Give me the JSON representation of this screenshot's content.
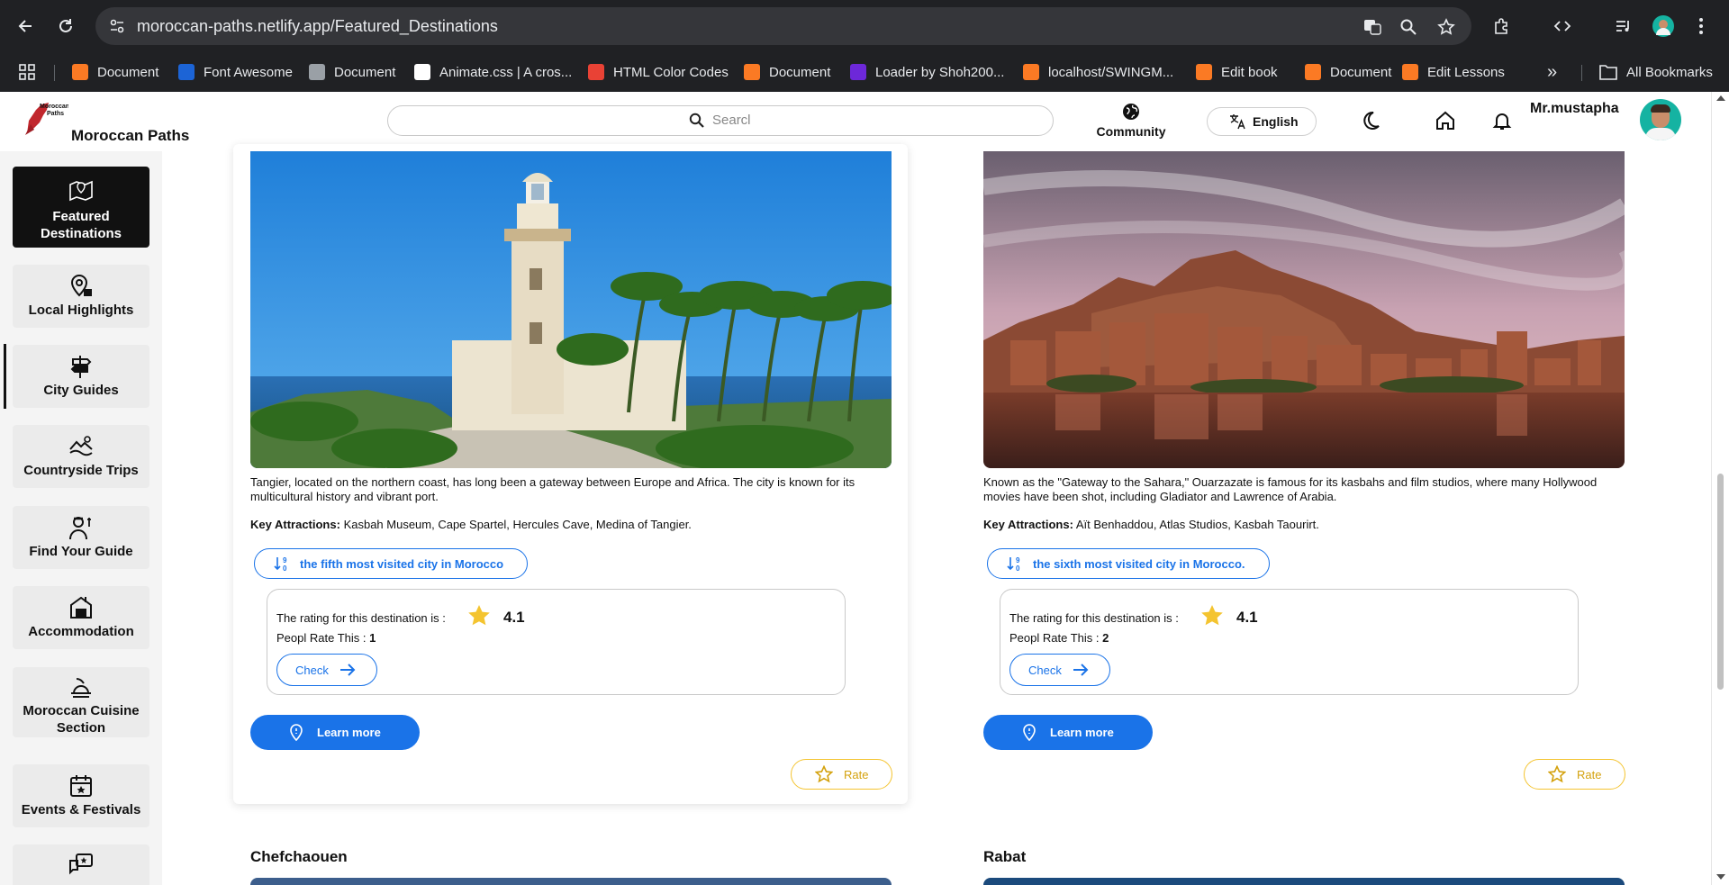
{
  "browser": {
    "url": "moroccan-paths.netlify.app/Featured_Destinations",
    "bookmarks": [
      {
        "label": "Document",
        "icon": "xampp-icon"
      },
      {
        "label": "Font Awesome",
        "icon": "font-awesome-icon"
      },
      {
        "label": "Document",
        "icon": "globe-icon"
      },
      {
        "label": "Animate.css | A cros...",
        "icon": "amazon-icon"
      },
      {
        "label": "HTML Color Codes",
        "icon": "html-color-codes-icon"
      },
      {
        "label": "Document",
        "icon": "xampp-icon"
      },
      {
        "label": "Loader by Shoh200...",
        "icon": "uiverse-icon"
      },
      {
        "label": "localhost/SWINGM...",
        "icon": "xampp-icon"
      },
      {
        "label": "Edit book",
        "icon": "xampp-icon"
      },
      {
        "label": "Document",
        "icon": "xampp-icon"
      },
      {
        "label": "Edit Lessons",
        "icon": "xampp-icon"
      }
    ],
    "all_bookmarks": "All Bookmarks",
    "more_bookmarks": "»"
  },
  "header": {
    "brand": "Moroccan Paths",
    "logo_text": "Moroccan Paths",
    "search_placeholder": "Searcl",
    "community": "Community",
    "language": "English",
    "username": "Mr.mustapha"
  },
  "sidebar": {
    "items": [
      {
        "label": "Featured Destinations",
        "icon": "map-icon",
        "active": true
      },
      {
        "label": "Local Highlights",
        "icon": "location-pin-icon",
        "active": false
      },
      {
        "label": "City Guides",
        "icon": "signpost-icon",
        "active": false
      },
      {
        "label": "Countryside Trips",
        "icon": "landscape-icon",
        "active": false
      },
      {
        "label": "Find Your Guide",
        "icon": "guide-icon",
        "active": false
      },
      {
        "label": "Accommodation",
        "icon": "hotel-icon",
        "active": false
      },
      {
        "label": "Moroccan Cuisine Section",
        "icon": "cuisine-icon",
        "active": false
      },
      {
        "label": "Events & Festivals",
        "icon": "calendar-icon",
        "active": false
      },
      {
        "label": "",
        "icon": "chat-icon",
        "active": false
      }
    ]
  },
  "destinations": [
    {
      "description": "Tangier, located on the northern coast, has long been a gateway between Europe and Africa. The city is known for its multicultural history and vibrant port.",
      "attractions_label": "Key Attractions:",
      "attractions": "Kasbah Museum, Cape Spartel, Hercules Cave, Medina of Tangier.",
      "rank": "the fifth most visited city in Morocco",
      "rating_text": "The rating for this destination is :",
      "rating": "4.1",
      "people_label": "Peopl Rate This :",
      "people_count": "1",
      "check": "Check",
      "learn_more": "Learn more",
      "rate": "Rate"
    },
    {
      "description": "Known as the \"Gateway to the Sahara,\" Ouarzazate is famous for its kasbahs and film studios, where many Hollywood movies have been shot, including Gladiator and Lawrence of Arabia.",
      "attractions_label": "Key Attractions:",
      "attractions": "Aït Benhaddou, Atlas Studios, Kasbah Taourirt.",
      "rank": "the sixth most visited city in Morocco.",
      "rating_text": "The rating for this destination is :",
      "rating": "4.1",
      "people_label": "Peopl Rate This :",
      "people_count": "2",
      "check": "Check",
      "learn_more": "Learn more",
      "rate": "Rate"
    }
  ],
  "next_cities": [
    "Chefchaouen",
    "Rabat"
  ],
  "colors": {
    "accent": "#1a73e8",
    "rate": "#f4c430",
    "sidebar_active": "#111111"
  }
}
